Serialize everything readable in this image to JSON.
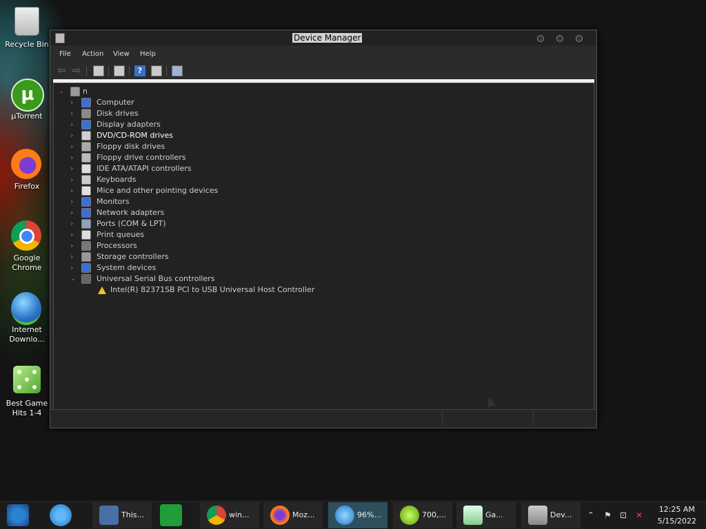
{
  "desktop": {
    "icons": [
      {
        "label": "Recycle Bin"
      },
      {
        "label": "µTorrent"
      },
      {
        "label": "Firefox"
      },
      {
        "label": "Google Chrome"
      },
      {
        "label": "Internet Downlo..."
      },
      {
        "label": "Best Game Hits 1-4"
      }
    ]
  },
  "window": {
    "title": "Device Manager",
    "menu": [
      "File",
      "Action",
      "View",
      "Help"
    ],
    "toolbar_icons": [
      "back-arrow-icon",
      "forward-arrow-icon",
      "show-hide-console-tree-icon",
      "properties-icon",
      "help-icon",
      "action-view-icon",
      "scan-hardware-icon"
    ],
    "tree": {
      "root": "n",
      "categories": [
        {
          "label": "Computer",
          "icon": "computer-icon",
          "expanded": false
        },
        {
          "label": "Disk drives",
          "icon": "disk-drive-icon",
          "expanded": false
        },
        {
          "label": "Display adapters",
          "icon": "display-adapter-icon",
          "expanded": false
        },
        {
          "label": "DVD/CD-ROM drives",
          "icon": "dvd-drive-icon",
          "expanded": false
        },
        {
          "label": "Floppy disk drives",
          "icon": "floppy-disk-icon",
          "expanded": false
        },
        {
          "label": "Floppy drive controllers",
          "icon": "floppy-controller-icon",
          "expanded": false
        },
        {
          "label": "IDE ATA/ATAPI controllers",
          "icon": "ide-controller-icon",
          "expanded": false
        },
        {
          "label": "Keyboards",
          "icon": "keyboard-icon",
          "expanded": false
        },
        {
          "label": "Mice and other pointing devices",
          "icon": "mouse-icon",
          "expanded": false
        },
        {
          "label": "Monitors",
          "icon": "monitor-icon",
          "expanded": false
        },
        {
          "label": "Network adapters",
          "icon": "network-adapter-icon",
          "expanded": false
        },
        {
          "label": "Ports (COM & LPT)",
          "icon": "port-icon",
          "expanded": false
        },
        {
          "label": "Print queues",
          "icon": "printer-icon",
          "expanded": false
        },
        {
          "label": "Processors",
          "icon": "processor-icon",
          "expanded": false
        },
        {
          "label": "Storage controllers",
          "icon": "storage-controller-icon",
          "expanded": false
        },
        {
          "label": "System devices",
          "icon": "system-device-icon",
          "expanded": false
        },
        {
          "label": "Universal Serial Bus controllers",
          "icon": "usb-icon",
          "expanded": true
        }
      ],
      "child_device": {
        "label": "Intel(R) 82371SB PCI to USB Universal Host Controller",
        "icon": "warning-icon"
      }
    }
  },
  "taskbar": {
    "pinned": [
      "media-center-icon",
      "internet-explorer-icon",
      "store-icon"
    ],
    "buttons": [
      {
        "label": "This...",
        "icon": "this-pc-icon"
      },
      {
        "label": "win...",
        "icon": "chrome-icon"
      },
      {
        "label": "Moz...",
        "icon": "firefox-icon"
      },
      {
        "label": "96%...",
        "icon": "idm-icon",
        "active": true
      },
      {
        "label": "700,...",
        "icon": "s-app-icon"
      },
      {
        "label": "Ga...",
        "icon": "game-installer-icon"
      },
      {
        "label": "Dev...",
        "icon": "device-manager-icon"
      }
    ],
    "tray": {
      "time": "12:25 AM",
      "date": "5/15/2022"
    }
  },
  "colors": {
    "window_bg": "#2b2b2b",
    "tree_bg": "#222222",
    "taskbar_bg": "#1b1b1b",
    "active_task": "#2e4f5c",
    "warning": "#f5c518"
  }
}
